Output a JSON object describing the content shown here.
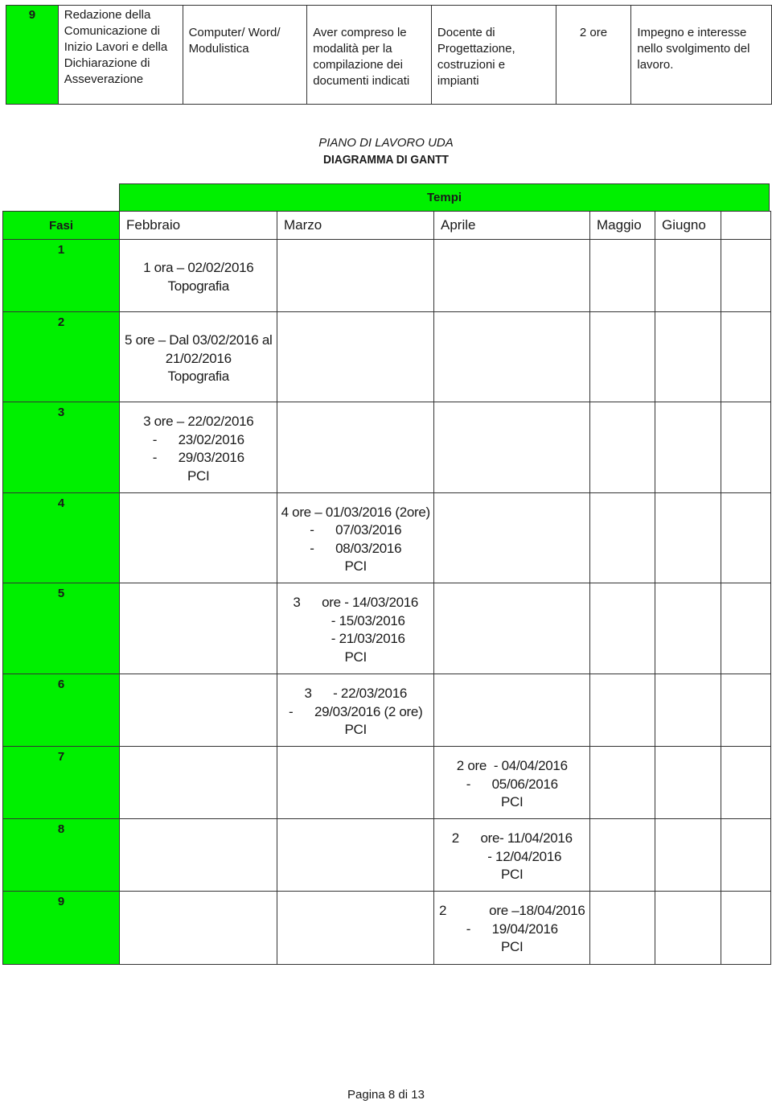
{
  "top_row": {
    "number": "9",
    "activity": "Redazione della Comunicazione di Inizio Lavori e della Dichiarazione di Asseverazione",
    "tools": "Computer/ Word/ Modulistica",
    "objectives": "Aver compreso le modalità per la compilazione dei documenti indicati",
    "teacher": "Docente di Progettazione, costruzioni e impianti",
    "duration": "2 ore",
    "evaluation": "Impegno e interesse nello svolgimento del lavoro."
  },
  "titles": {
    "plan": "PIANO DI LAVORO UDA",
    "gantt": "DIAGRAMMA DI GANTT"
  },
  "gantt": {
    "tempi_label": "Tempi",
    "fasi_label": "Fasi",
    "months": [
      "Febbraio",
      "Marzo",
      "Aprile",
      "Maggio",
      "Giugno",
      ""
    ],
    "phases": [
      "1",
      "2",
      "3",
      "4",
      "5",
      "6",
      "7",
      "8",
      "9"
    ],
    "tasks": [
      {
        "phase": "1",
        "month": "Febbraio",
        "text": "1 ora – 02/02/2016\nTopografia"
      },
      {
        "phase": "2",
        "month": "Febbraio",
        "text": "5 ore – Dal 03/02/2016 al\n21/02/2016\nTopografia"
      },
      {
        "phase": "3",
        "month": "Febbraio",
        "text": "3 ore – 22/02/2016\n-      23/02/2016\n-      29/03/2016\nPCI"
      },
      {
        "phase": "4",
        "month": "Marzo",
        "text": "4 ore – 01/03/2016 (2ore)\n-      07/03/2016\n-      08/03/2016\nPCI"
      },
      {
        "phase": "5",
        "month": "Marzo",
        "text": "3      ore - 14/03/2016\n       - 15/03/2016\n       - 21/03/2016\nPCI"
      },
      {
        "phase": "6",
        "month": "Marzo",
        "text": "3      - 22/03/2016\n-      29/03/2016 (2 ore)\nPCI"
      },
      {
        "phase": "7",
        "month": "Aprile",
        "text": "2 ore  - 04/04/2016\n-      05/06/2016\nPCI"
      },
      {
        "phase": "8",
        "month": "Aprile",
        "text": "2      ore- 11/04/2016\n       - 12/04/2016\nPCI"
      },
      {
        "phase": "9",
        "month": "Aprile",
        "text": "2            ore –18/04/2016\n-      19/04/2016\nPCI"
      }
    ]
  },
  "footer": {
    "page": "Pagina 8 di 13"
  }
}
